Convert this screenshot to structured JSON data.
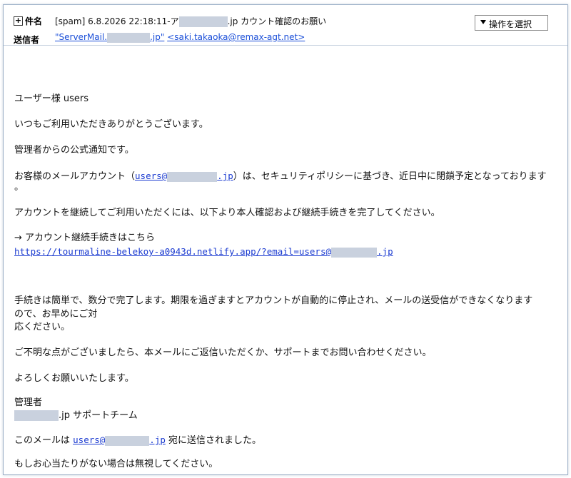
{
  "header": {
    "subject_label": "件名",
    "subject_prefix": "[spam]  6.8.2026 22:18:11-ア",
    "subject_suffix": ".jp カウント確認のお願い",
    "sender_label": "送信者",
    "sender_name_prefix": "\"ServerMail.",
    "sender_name_suffix": ".jp\"",
    "sender_email": "<saki.takaoka@remax-agt.net>",
    "action_button": "操作を選択"
  },
  "body": {
    "greeting": "ユーザー様 users",
    "line_thanks": "いつもご利用いただきありがとうございます。",
    "line_notice": "管理者からの公式通知です。",
    "account_pre": "お客様のメールアカウント（",
    "account_link_prefix": "users@",
    "account_link_suffix": ".jp",
    "account_post": "）は、セキュリティポリシーに基づき、近日中に閉鎖予定となっております",
    "account_wrap": "。",
    "continue_line": "アカウントを継続してご利用いただくには、以下より本人確認および継続手続きを完了してください。",
    "arrow_line": "→ アカウント継続手続きはこちら",
    "phish_link_prefix": "https://tourmaline-belekoy-a0943d.netlify.app/?email=users@",
    "phish_link_suffix": ".jp",
    "procedure_line1": "手続きは簡単で、数分で完了します。期限を過ぎますとアカウントが自動的に停止され、メールの送受信ができなくなります",
    "procedure_line2": "ので、お早めにご対",
    "procedure_line3": "応ください。",
    "questions_line": "ご不明な点がございましたら、本メールにご返信いただくか、サポートまでお問い合わせください。",
    "regards": "よろしくお願いいたします。",
    "signature_title": "管理者",
    "signature_team_suffix": ".jp サポートチーム",
    "sent_to_pre": "このメールは ",
    "sent_to_link_prefix": "users@",
    "sent_to_link_suffix": ".jp",
    "sent_to_post": " 宛に送信されました。",
    "ignore_line": "もしお心当たりがない場合は無視してください。"
  }
}
